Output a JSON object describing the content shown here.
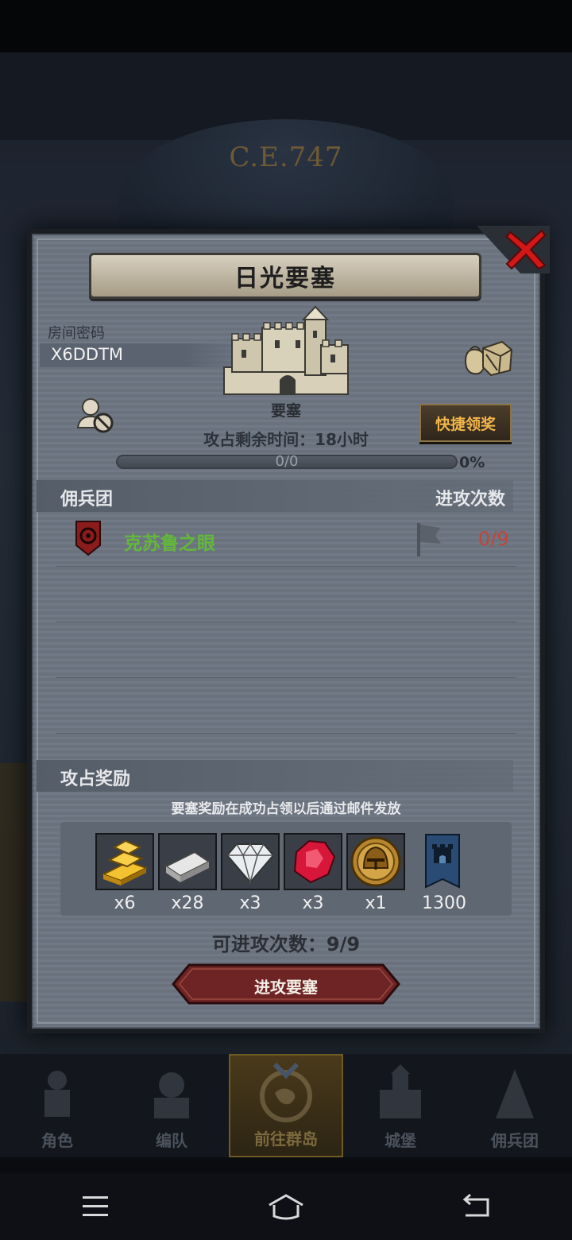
{
  "background": {
    "era_text": "C.E.747"
  },
  "dialog": {
    "title": "日光要塞",
    "room_code_label": "房间密码",
    "room_code_value": "X6DDTM",
    "fortress_label": "要塞",
    "quick_claim_label": "快捷领奖",
    "time_left_text": "攻占剩余时间：18小时",
    "progress": {
      "text": "0/0",
      "percent_text": "0%",
      "fraction": 0
    },
    "mercenary_header": "佣兵团",
    "attack_count_header": "进攻次数",
    "mercenaries": [
      {
        "name": "克苏鲁之眼",
        "attacks": "0/9",
        "name_color": "#62b83a",
        "attacks_color": "#c2443b"
      }
    ],
    "rewards_header": "攻占奖励",
    "reward_note": "要塞奖励在成功占领以后通过邮件发放",
    "rewards": [
      {
        "icon": "gold-bars-icon",
        "qty": "x6"
      },
      {
        "icon": "silver-ingot-icon",
        "qty": "x28"
      },
      {
        "icon": "diamond-icon",
        "qty": "x3"
      },
      {
        "icon": "ruby-icon",
        "qty": "x3"
      },
      {
        "icon": "helmet-medal-icon",
        "qty": "x1"
      },
      {
        "icon": "guild-banner-icon",
        "qty": "1300"
      }
    ],
    "attacks_available_text": "可进攻次数：9/9",
    "attack_button_label": "进攻要塞"
  },
  "bottom_nav": {
    "items": [
      {
        "label": "角色",
        "icon": "knight-icon"
      },
      {
        "label": "编队",
        "icon": "formation-icon"
      },
      {
        "label": "前往群岛",
        "icon": "islands-compass-icon",
        "active": true
      },
      {
        "label": "城堡",
        "icon": "castle-icon"
      },
      {
        "label": "佣兵团",
        "icon": "mercenary-icon"
      }
    ]
  },
  "colors": {
    "accent_gold": "#f2b54a",
    "mercenary_green": "#62b83a",
    "count_red": "#c2443b",
    "close_red": "#d01818"
  }
}
